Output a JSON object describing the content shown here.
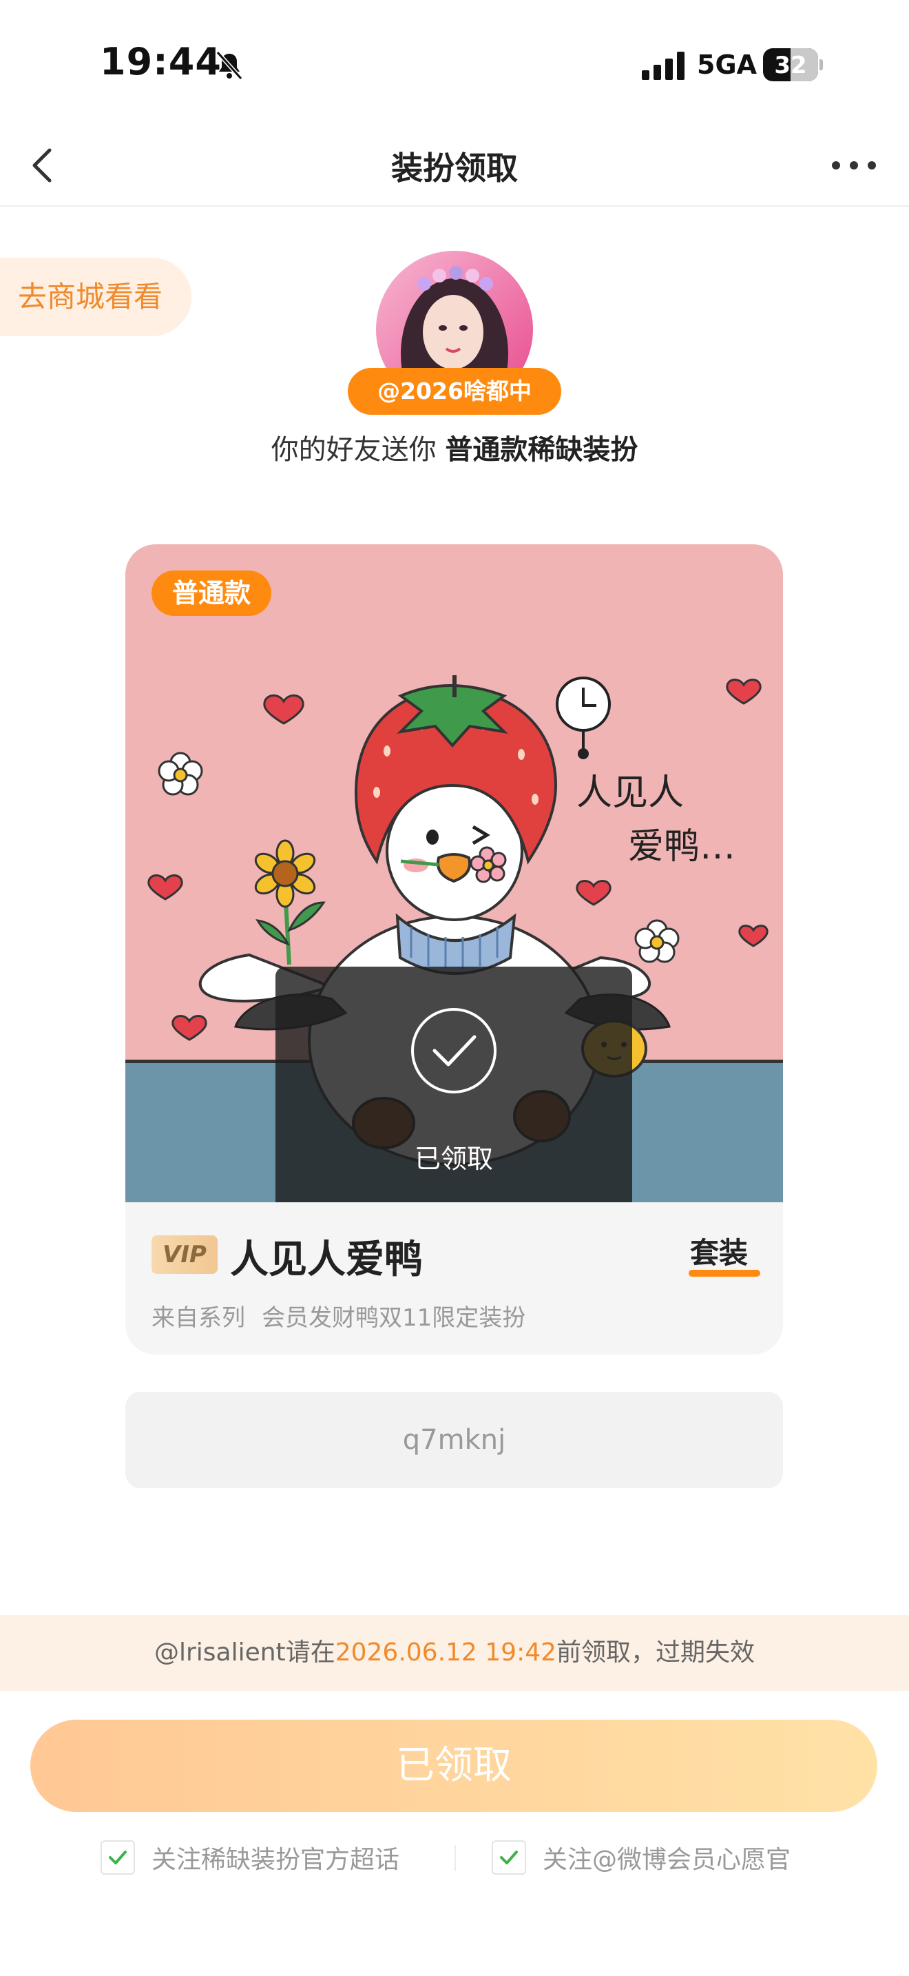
{
  "status_bar": {
    "time": "19:44",
    "network": "5GA",
    "battery": "32"
  },
  "nav": {
    "title": "装扮领取"
  },
  "shop_link": "去商城看看",
  "sender": {
    "username": "@2026啥都中"
  },
  "gift_message": {
    "prefix": "你的好友送你 ",
    "highlight": "普通款稀缺装扮"
  },
  "card": {
    "tier_badge": "普通款",
    "art_text_line1": "人见人",
    "art_text_line2": "爱鸭…",
    "overlay_label": "已领取",
    "vip_badge": "VIP",
    "item_name": "人见人爱鸭",
    "item_kind": "套装",
    "series_prefix": "来自系列",
    "series_name": "会员发财鸭双11限定装扮"
  },
  "code": "q7mknj",
  "deadline": {
    "user": "@lrisalient",
    "before": "请在",
    "date": "2026.06.12 19:42",
    "after": "前领取，过期失效"
  },
  "claim_button": "已领取",
  "follow_options": [
    {
      "label": "关注稀缺装扮官方超话",
      "checked": true
    },
    {
      "label": "关注@微博会员心愿官",
      "checked": true
    }
  ],
  "colors": {
    "accent": "#ff8a10",
    "card_pink": "#f0b4b5",
    "floor_blue": "#6c95aa",
    "check_green": "#3cb34a"
  }
}
